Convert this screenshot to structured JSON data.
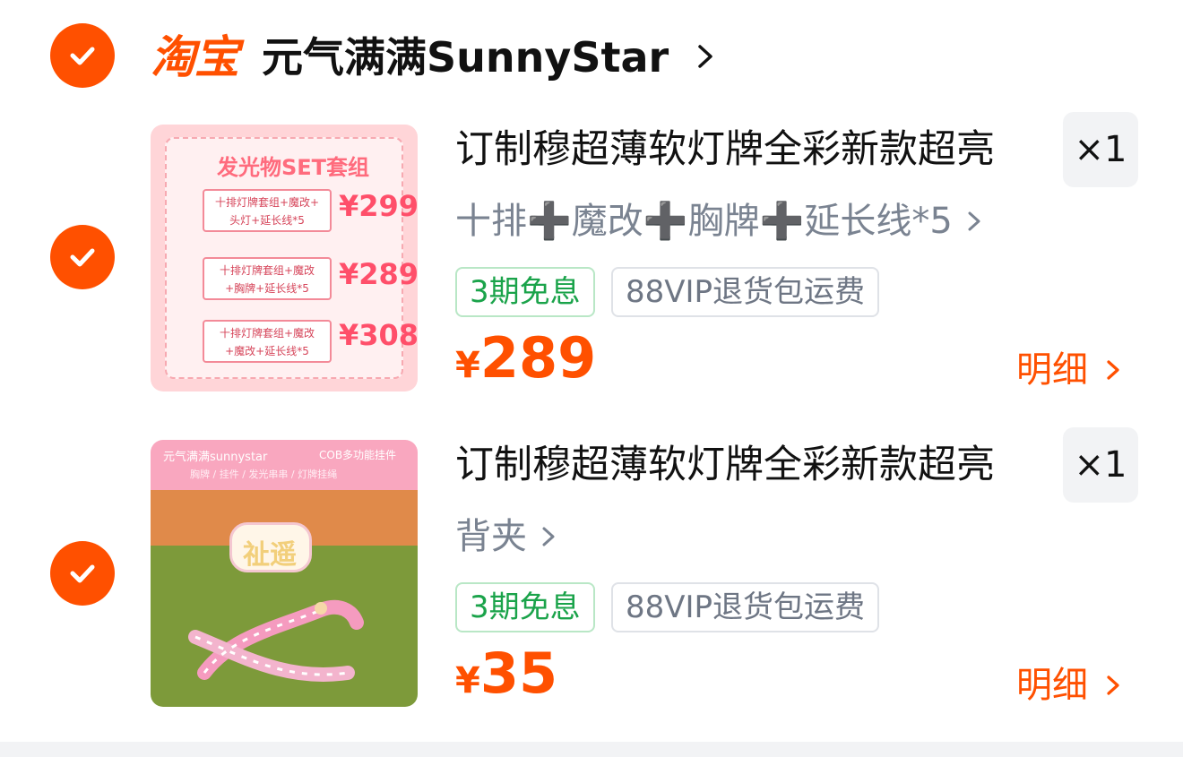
{
  "shop": {
    "logo_text": "淘宝",
    "name": "元气满满SunnyStar"
  },
  "items": [
    {
      "title": "订制穆超薄软灯牌全彩新款超亮",
      "quantity": "×1",
      "sku": "十排➕魔改➕胸牌➕延长线*5",
      "tag_installment": "3期免息",
      "tag_return": "88VIP退货包运费",
      "price_symbol": "¥",
      "price": "289",
      "detail_label": "明细",
      "thumb": {
        "heading": "发光物SET套组",
        "rows": [
          {
            "text1": "十排灯牌套组+魔改+",
            "text2": "头灯+延长线*5",
            "price": "¥299"
          },
          {
            "text1": "十排灯牌套组+魔改",
            "text2": "+胸牌+延长线*5",
            "price": "¥289"
          },
          {
            "text1": "十排灯牌套组+魔改",
            "text2": "+魔改+延长线*5",
            "price": "¥308"
          }
        ]
      }
    },
    {
      "title": "订制穆超薄软灯牌全彩新款超亮",
      "quantity": "×1",
      "sku": "背夹",
      "tag_installment": "3期免息",
      "tag_return": "88VIP退货包运费",
      "price_symbol": "¥",
      "price": "35",
      "detail_label": "明细",
      "thumb": {
        "brand": "元气满满sunnystar",
        "subtitle": "COB多功能挂件",
        "categories": "胸牌 / 挂件 / 发光串串 / 灯牌挂绳",
        "sign_text": "祉遥"
      }
    }
  ],
  "colors": {
    "accent": "#ff5000",
    "green_tag": "#1aa34a",
    "sku_gray": "#7a8391"
  },
  "icons": {
    "check": "check-icon",
    "chevron": "chevron-right-icon"
  }
}
